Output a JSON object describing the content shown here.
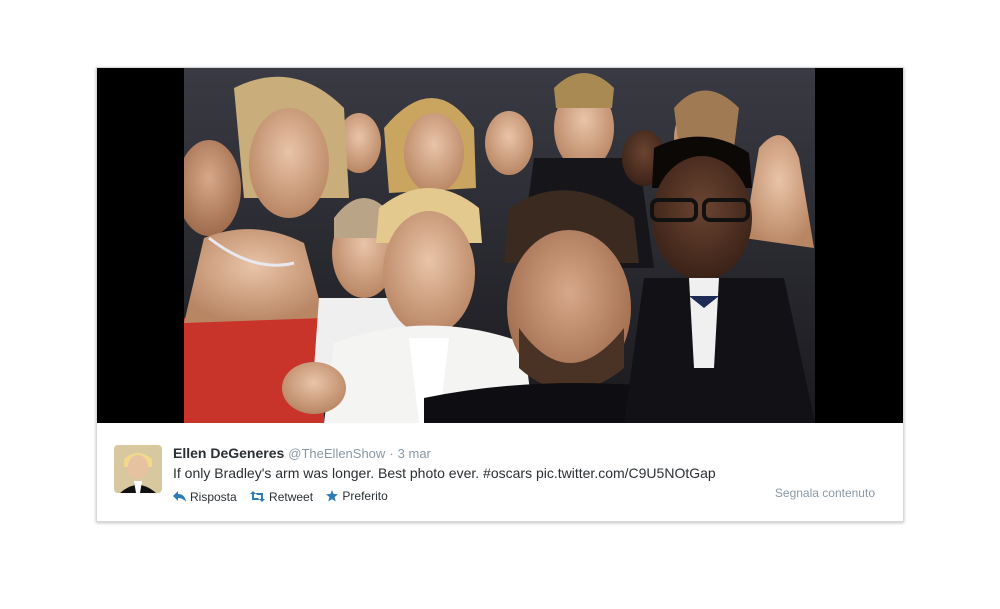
{
  "tweet": {
    "author_name": "Ellen DeGeneres",
    "author_handle": "@TheEllenShow",
    "separator": "·",
    "timestamp": "3 mar",
    "text": "If only Bradley's arm was longer. Best photo ever. #oscars pic.twitter.com/C9U5NOtGap"
  },
  "actions": {
    "reply_label": "Risposta",
    "retweet_label": "Retweet",
    "favorite_label": "Preferito",
    "report_label": "Segnala contenuto"
  },
  "icons": {
    "reply": "reply-icon",
    "retweet": "retweet-icon",
    "favorite": "star-icon"
  },
  "colors": {
    "action_icon": "#2b7bb9",
    "muted_text": "#8899a6",
    "main_text": "#292f33"
  }
}
